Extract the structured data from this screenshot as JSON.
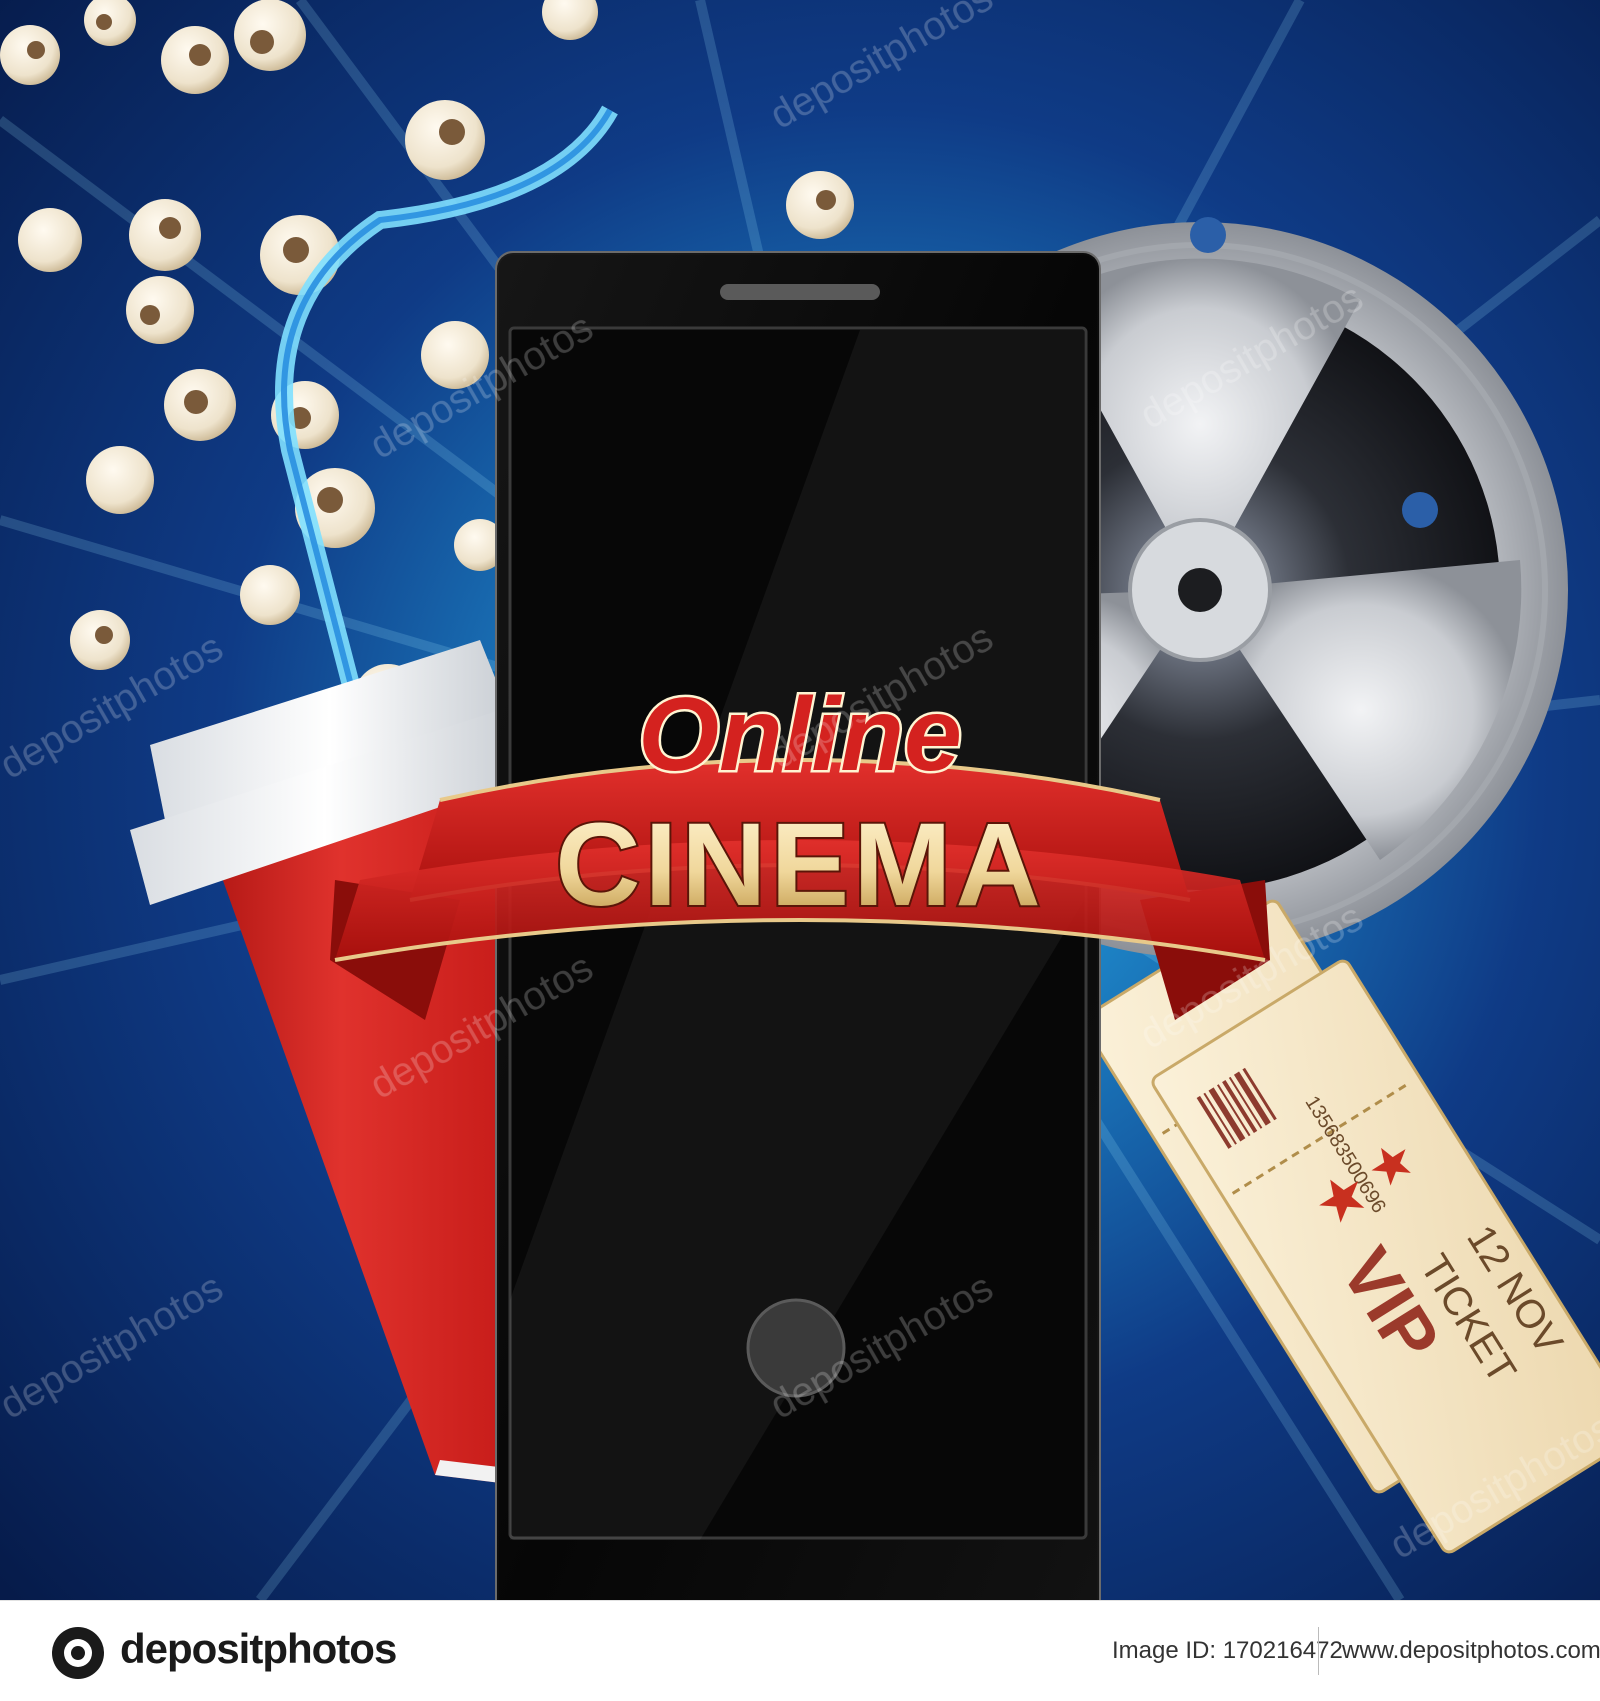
{
  "headline": {
    "script_word": "Online",
    "banner_word": "CINEMA"
  },
  "tickets": {
    "type": "VIP",
    "label": "TICKET",
    "date": "12 NOV",
    "barcode_number": "135683500696"
  },
  "watermark": {
    "text": "depositphotos"
  },
  "footer": {
    "brand": "depositphotos",
    "image_id": "Image ID: 170216472",
    "site_url": "www.depositphotos.com"
  },
  "colors": {
    "background": "#0f3b86",
    "glow": "#4fd0ee",
    "ribbon": "#c8191e",
    "gold": "#e6c98a",
    "phone": "#0b0b0b",
    "cup": "#d4221f"
  }
}
